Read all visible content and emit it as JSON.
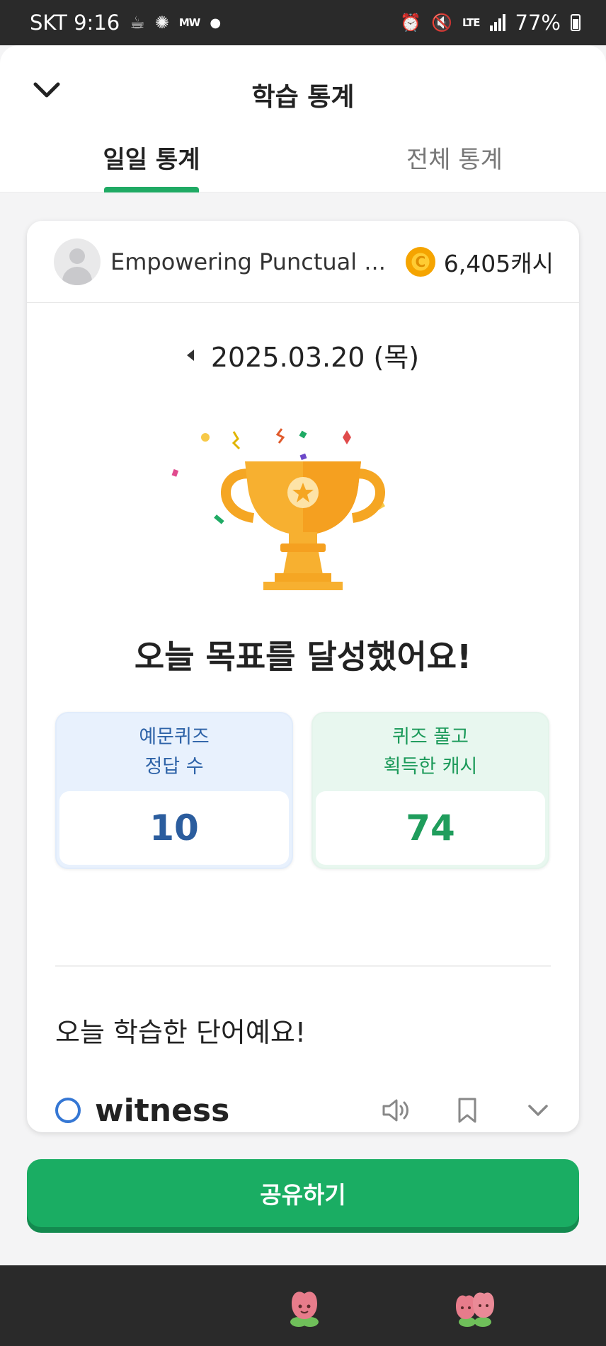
{
  "status_bar": {
    "carrier_time": "SKT 9:16",
    "mini_label": "MW",
    "network": "LTE",
    "battery": "77%"
  },
  "header": {
    "title": "학습 통계",
    "tabs": [
      {
        "label": "일일 통계",
        "active": true
      },
      {
        "label": "전체 통계",
        "active": false
      }
    ]
  },
  "card": {
    "username": "Empowering Punctual ...",
    "cash": "6,405캐시",
    "date": "2025.03.20 (목)",
    "goal_message": "오늘 목표를 달성했어요!",
    "stats": [
      {
        "line1": "예문퀴즈",
        "line2": "정답 수",
        "value": "10",
        "color": "#2b5d9e"
      },
      {
        "line1": "퀴즈 풀고",
        "line2": "획득한 캐시",
        "value": "74",
        "color": "#1f9d5c"
      }
    ],
    "words_title": "오늘 학습한 단어예요!",
    "words": [
      {
        "word": "witness"
      }
    ]
  },
  "share_button": "공유하기",
  "colors": {
    "accent": "#1aad63",
    "blue": "#2b5d9e",
    "ring": "#3577d4",
    "trophy": "#f5a623"
  },
  "icons": [
    "chevron-down-icon",
    "coin-icon",
    "trophy-icon",
    "speaker-icon",
    "bookmark-icon",
    "expand-icon"
  ]
}
